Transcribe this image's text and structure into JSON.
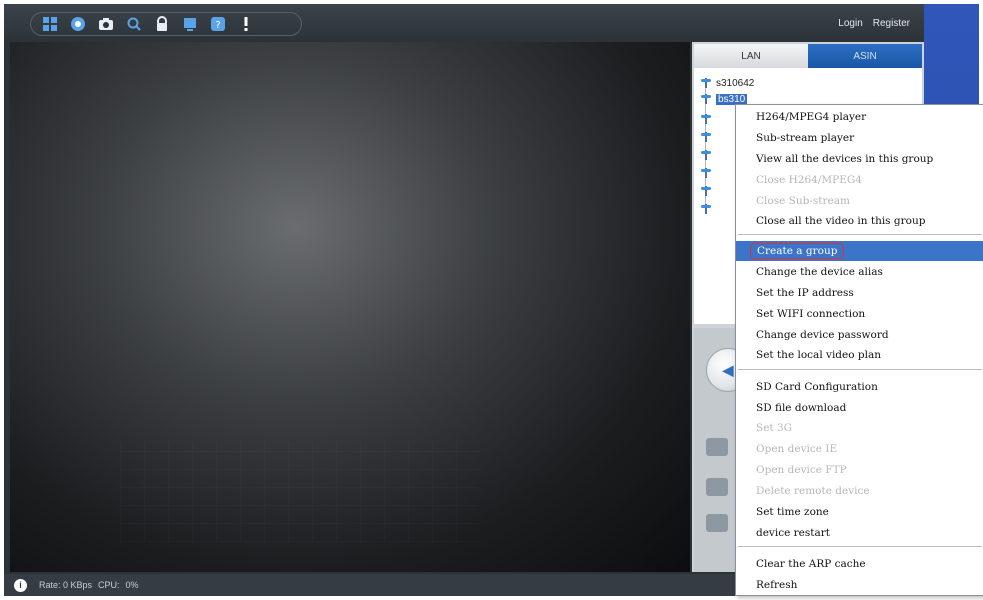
{
  "toolbar": {
    "icons": [
      "tile-view-icon",
      "record-icon",
      "camera-icon",
      "search-icon",
      "lock-icon",
      "display-icon",
      "help-icon",
      "alert-icon"
    ],
    "login_label": "Login",
    "register_label": "Register"
  },
  "status": {
    "rate_label": "Rate: 0 KBps",
    "cpu_label": "CPU:",
    "cpu_value": "0%"
  },
  "panel": {
    "tab_lan": "LAN",
    "tab_asin": "ASIN",
    "tree_items": [
      {
        "label": "s310642",
        "selected": false
      },
      {
        "label": "bs310",
        "selected": true
      }
    ]
  },
  "context_menu": {
    "items": [
      {
        "label": "H264/MPEG4 player",
        "state": "enabled"
      },
      {
        "label": "Sub-stream player",
        "state": "enabled"
      },
      {
        "label": "View all the devices in this group",
        "state": "enabled"
      },
      {
        "label": "Close H264/MPEG4",
        "state": "disabled"
      },
      {
        "label": "Close Sub-stream",
        "state": "disabled"
      },
      {
        "label": "Close all the video in this group",
        "state": "enabled"
      },
      {
        "label": "Create a group",
        "state": "highlighted"
      },
      {
        "label": "Change the device alias",
        "state": "enabled"
      },
      {
        "label": "Set the IP address",
        "state": "enabled"
      },
      {
        "label": "Set WIFI connection",
        "state": "enabled"
      },
      {
        "label": "Change device password",
        "state": "enabled"
      },
      {
        "label": "Set the local video plan",
        "state": "enabled"
      },
      {
        "label": "SD Card Configuration",
        "state": "enabled"
      },
      {
        "label": "SD file download",
        "state": "enabled"
      },
      {
        "label": "Set 3G",
        "state": "disabled"
      },
      {
        "label": "Open device IE",
        "state": "disabled"
      },
      {
        "label": "Open device FTP",
        "state": "disabled"
      },
      {
        "label": "Delete remote device",
        "state": "disabled"
      },
      {
        "label": "Set time zone",
        "state": "enabled"
      },
      {
        "label": "device restart",
        "state": "enabled"
      },
      {
        "label": "Clear the ARP cache",
        "state": "enabled"
      },
      {
        "label": "Refresh",
        "state": "enabled"
      }
    ]
  },
  "colors": {
    "menu_highlight": "#3b74c9",
    "highlight_ring": "#e0302f",
    "tab_active": "#1a57a6"
  }
}
